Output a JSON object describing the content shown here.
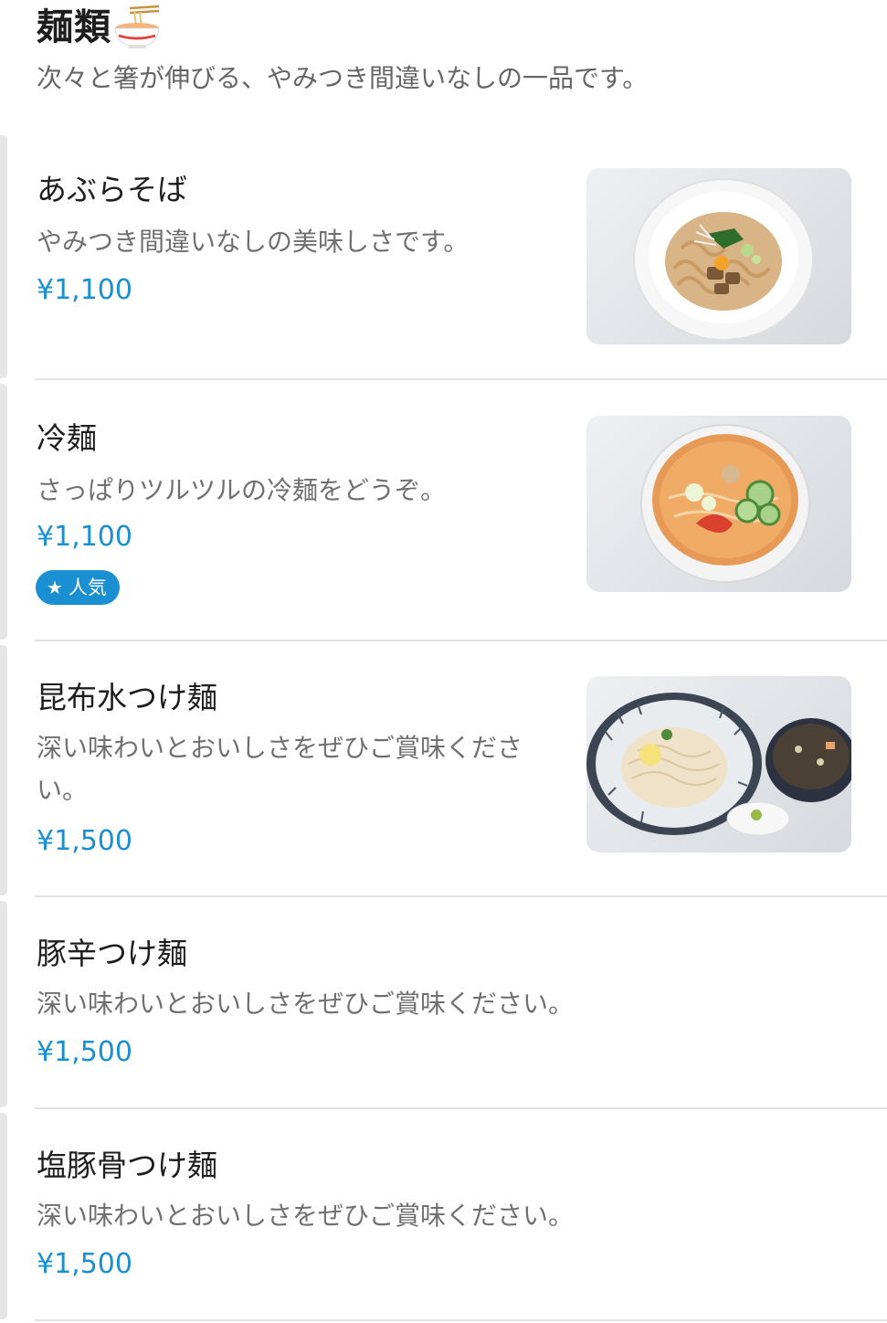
{
  "section": {
    "title": "麺類",
    "emoji_icon": "noodle-bowl-icon",
    "description": "次々と箸が伸びる、やみつき間違いなしの一品です。"
  },
  "colors": {
    "price": "#1a8fd1",
    "badge_bg": "#1a8fd1",
    "divider": "#e2e2e2"
  },
  "items": [
    {
      "name": "あぶらそば",
      "description": "やみつき間違いなしの美味しさです。",
      "price": "¥1,100",
      "image": "abura-soba-photo"
    },
    {
      "name": "冷麺",
      "description": "さっぱりツルツルの冷麺をどうぞ。",
      "price": "¥1,100",
      "badge": "人気",
      "badge_icon": "star-icon",
      "image": "reimen-photo"
    },
    {
      "name": "昆布水つけ麺",
      "description": "深い味わいとおいしさをぜひご賞味ください。",
      "price": "¥1,500",
      "image": "kombu-tsukemen-photo"
    },
    {
      "name": "豚辛つけ麺",
      "description": "深い味わいとおいしさをぜひご賞味ください。",
      "price": "¥1,500"
    },
    {
      "name": "塩豚骨つけ麺",
      "description": "深い味わいとおいしさをぜひご賞味ください。",
      "price": "¥1,500"
    }
  ]
}
